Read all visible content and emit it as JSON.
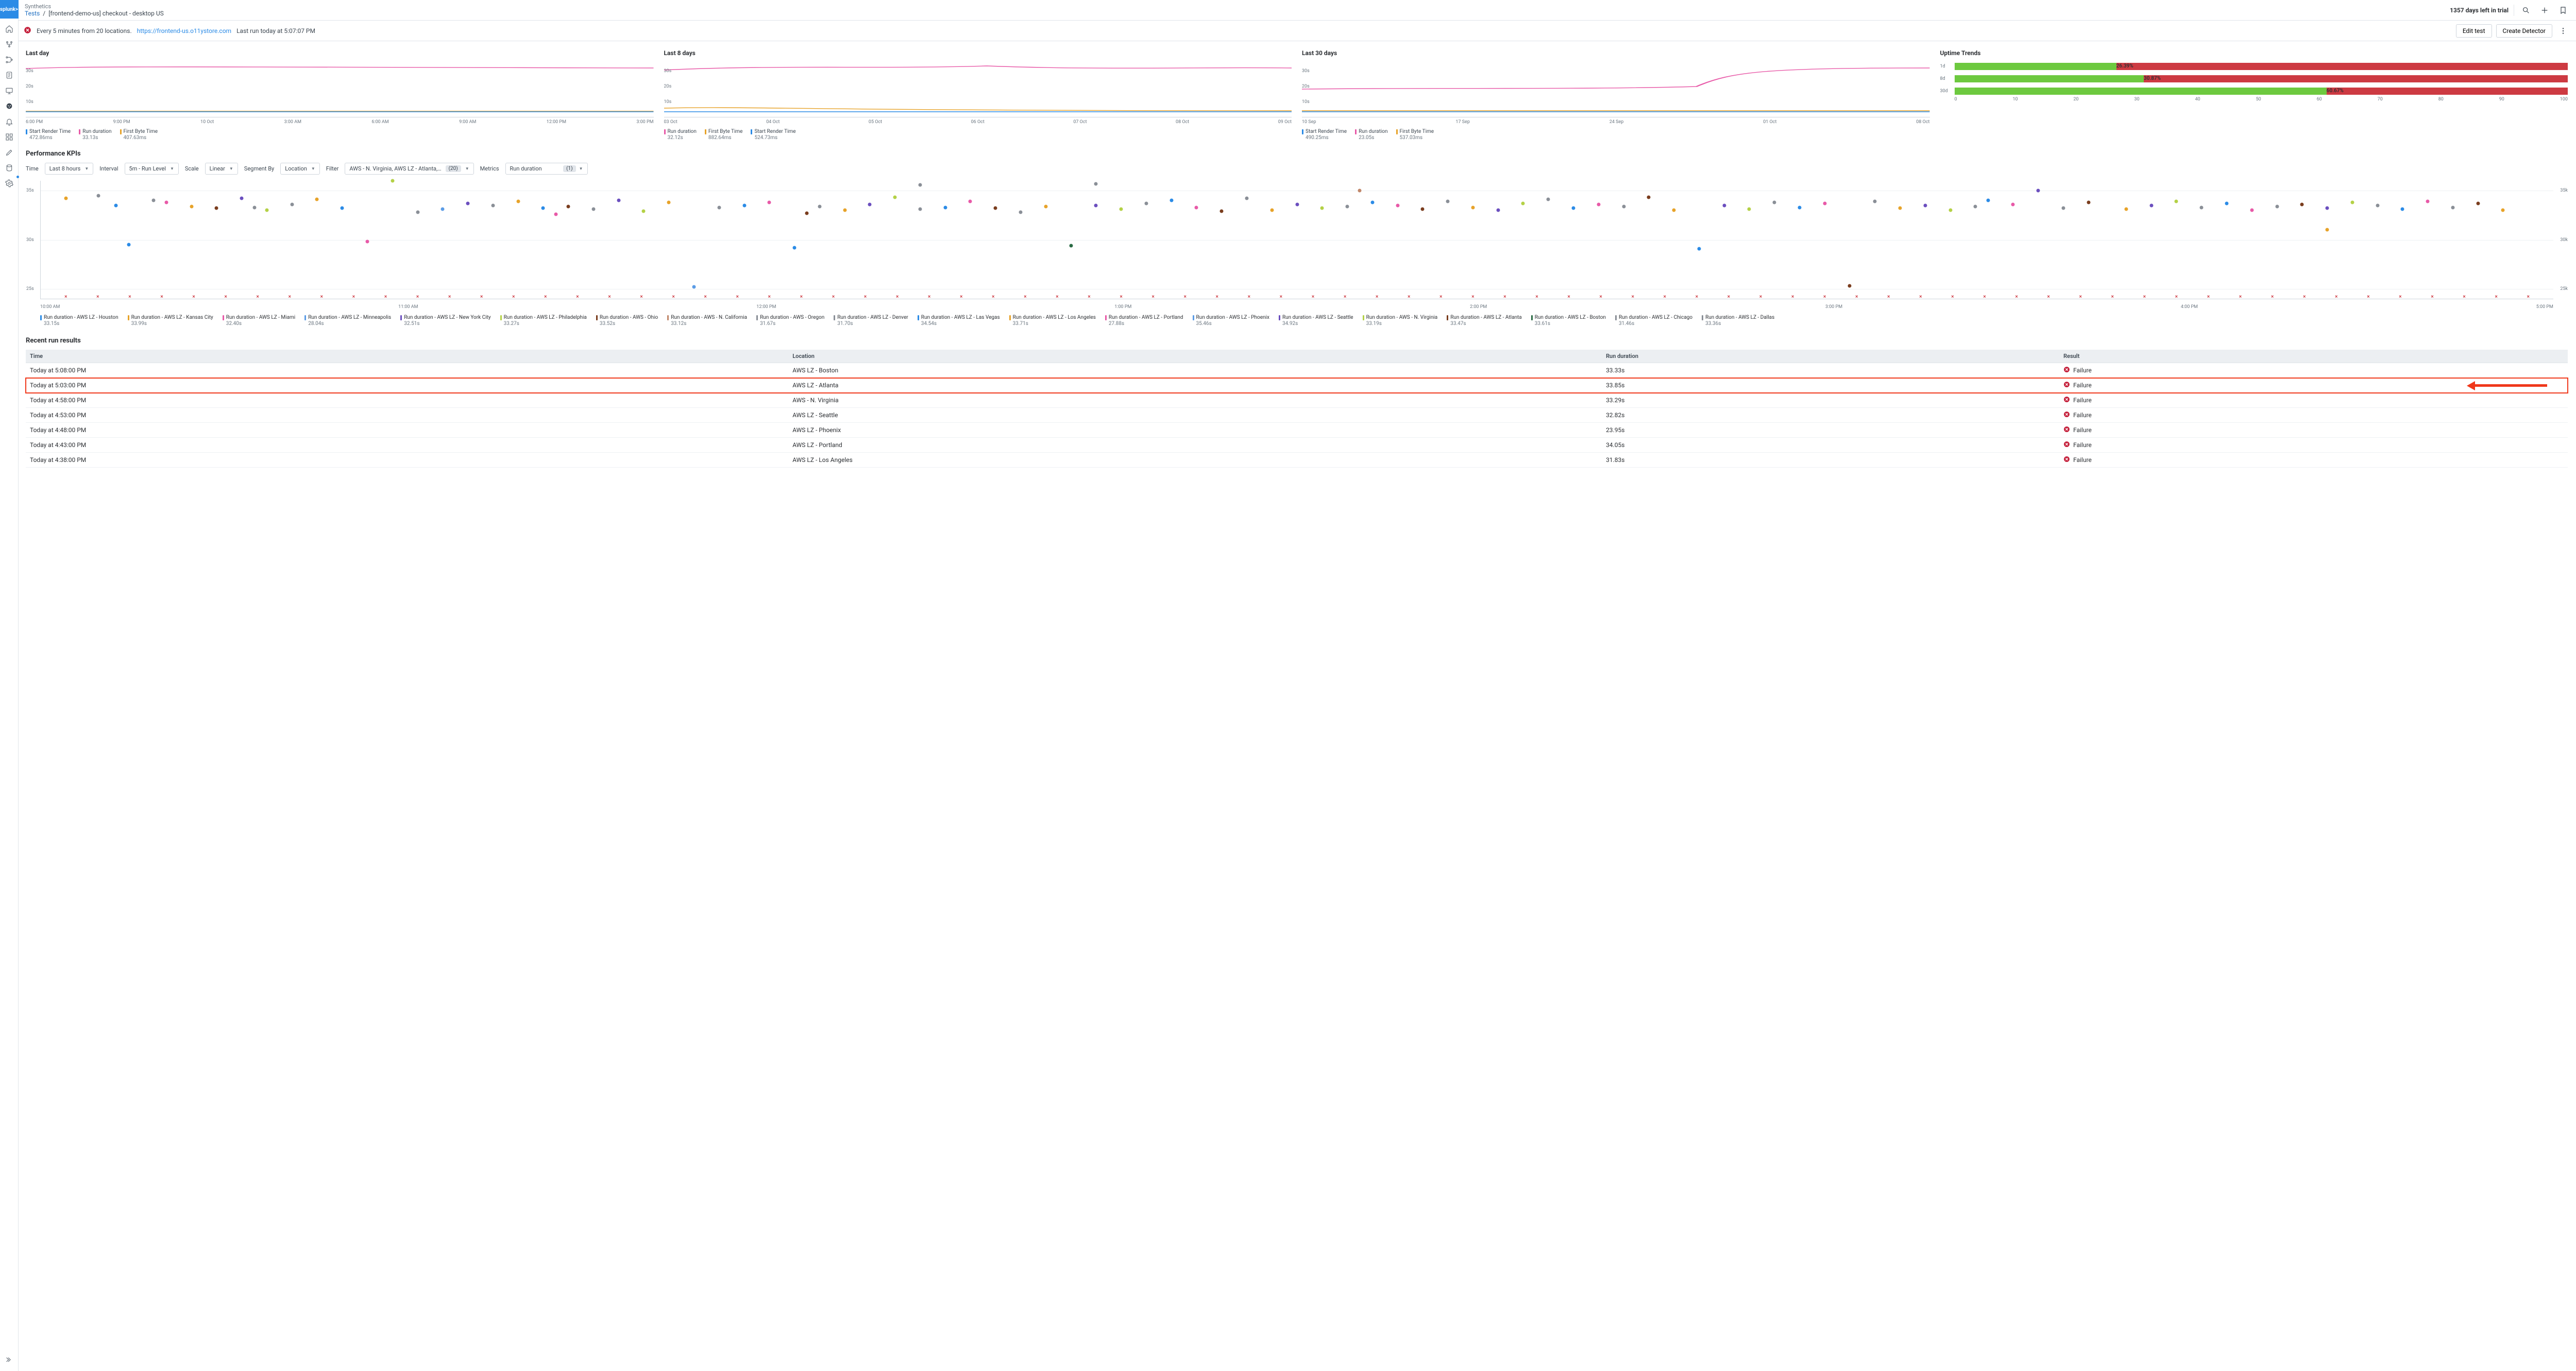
{
  "brand": "splunk>",
  "breadcrumb": {
    "root": "Synthetics",
    "tests": "Tests",
    "current": "[frontend-demo-us] checkout - desktop US"
  },
  "topbar": {
    "trial": "1357 days left in trial"
  },
  "actionbar": {
    "schedule": "Every 5 minutes from 20 locations.",
    "url": "https://frontend-us.o11ystore.com",
    "lastrun": "Last run today at 5:07:07 PM",
    "edit": "Edit test",
    "createDetector": "Create Detector"
  },
  "mini": [
    {
      "title": "Last day",
      "yt": [
        "30s",
        "20s",
        "10s"
      ],
      "xt": [
        "6:00 PM",
        "9:00 PM",
        "10 Oct",
        "3:00 AM",
        "6:00 AM",
        "9:00 AM",
        "12:00 PM",
        "3:00 PM"
      ],
      "legend": [
        {
          "label": "Start Render Time",
          "val": "472.86ms",
          "c": "#2b8be6"
        },
        {
          "label": "Run duration",
          "val": "33.13s",
          "c": "#e85aa8"
        },
        {
          "label": "First Byte Time",
          "val": "407.63ms",
          "c": "#e7a32a"
        }
      ]
    },
    {
      "title": "Last 8 days",
      "yt": [
        "30s",
        "20s",
        "10s"
      ],
      "xt": [
        "03 Oct",
        "04 Oct",
        "05 Oct",
        "06 Oct",
        "07 Oct",
        "08 Oct",
        "09 Oct"
      ],
      "legend": [
        {
          "label": "Run duration",
          "val": "32.12s",
          "c": "#e85aa8"
        },
        {
          "label": "First Byte Time",
          "val": "882.64ms",
          "c": "#e7a32a"
        },
        {
          "label": "Start Render Time",
          "val": "524.73ms",
          "c": "#2b8be6"
        }
      ]
    },
    {
      "title": "Last 30 days",
      "yt": [
        "30s",
        "20s",
        "10s"
      ],
      "xt": [
        "10 Sep",
        "17 Sep",
        "24 Sep",
        "01 Oct",
        "08 Oct"
      ],
      "legend": [
        {
          "label": "Start Render Time",
          "val": "490.25ms",
          "c": "#2b8be6"
        },
        {
          "label": "Run duration",
          "val": "23.05s",
          "c": "#e85aa8"
        },
        {
          "label": "First Byte Time",
          "val": "537.03ms",
          "c": "#e7a32a"
        }
      ]
    }
  ],
  "trends": {
    "title": "Uptime Trends",
    "rows": [
      {
        "lbl": "1d",
        "pct": "26.39%",
        "pctv": 26.39
      },
      {
        "lbl": "8d",
        "pct": "30.87%",
        "pctv": 30.87
      },
      {
        "lbl": "30d",
        "pct": "60.67%",
        "pctv": 60.67
      }
    ],
    "xt": [
      "0",
      "10",
      "20",
      "30",
      "40",
      "50",
      "60",
      "70",
      "80",
      "90",
      "100"
    ]
  },
  "kpi": {
    "title": "Performance KPIs",
    "labels": {
      "time": "Time",
      "interval": "Interval",
      "scale": "Scale",
      "segment": "Segment By",
      "filter": "Filter",
      "metrics": "Metrics"
    },
    "time": "Last 8 hours",
    "interval": "5m - Run Level",
    "scale": "Linear",
    "segment": "Location",
    "filterText": "AWS - N. Virginia, AWS LZ - Atlanta,…",
    "filterCount": "(20)",
    "metricsText": "Run duration",
    "metricsCount": "(1)"
  },
  "chart_data": {
    "type": "scatter",
    "ylabel": "Run duration",
    "ylim": [
      24,
      36
    ],
    "yticks": [
      "35s",
      "30s",
      "25s"
    ],
    "yticks_r": [
      "35k",
      "30k",
      "25k"
    ],
    "xticks": [
      "10:00 AM",
      "11:00 AM",
      "12:00 PM",
      "1:00 PM",
      "2:00 PM",
      "3:00 PM",
      "4:00 PM",
      "5:00 PM"
    ],
    "series": [
      {
        "name": "Run duration - AWS LZ - Houston",
        "val": "33.15s",
        "c": "#2b8be6"
      },
      {
        "name": "Run duration - AWS LZ - Kansas City",
        "val": "33.99s",
        "c": "#e7a32a"
      },
      {
        "name": "Run duration - AWS LZ - Miami",
        "val": "32.40s",
        "c": "#e85aa8"
      },
      {
        "name": "Run duration - AWS LZ - Minneapolis",
        "val": "28.04s",
        "c": "#5b9ce6"
      },
      {
        "name": "Run duration - AWS LZ - New York City",
        "val": "32.51s",
        "c": "#6b4fbf"
      },
      {
        "name": "Run duration - AWS LZ - Philadelphia",
        "val": "33.27s",
        "c": "#b4d146"
      },
      {
        "name": "Run duration - AWS - Ohio",
        "val": "33.52s",
        "c": "#7a3d1e"
      },
      {
        "name": "Run duration - AWS - N. California",
        "val": "33.12s",
        "c": "#c1876a"
      },
      {
        "name": "Run duration - AWS - Oregon",
        "val": "31.67s",
        "c": "#8a8f97"
      },
      {
        "name": "Run duration - AWS LZ - Denver",
        "val": "31.70s",
        "c": "#8a8f97"
      },
      {
        "name": "Run duration - AWS LZ - Las Vegas",
        "val": "34.54s",
        "c": "#2b8be6"
      },
      {
        "name": "Run duration - AWS LZ - Los Angeles",
        "val": "33.71s",
        "c": "#e7a32a"
      },
      {
        "name": "Run duration - AWS LZ - Portland",
        "val": "27.88s",
        "c": "#e85aa8"
      },
      {
        "name": "Run duration - AWS LZ - Phoenix",
        "val": "35.46s",
        "c": "#5b9ce6"
      },
      {
        "name": "Run duration - AWS LZ - Seattle",
        "val": "34.92s",
        "c": "#6b4fbf"
      },
      {
        "name": "Run duration - AWS - N. Virginia",
        "val": "33.19s",
        "c": "#b4d146"
      },
      {
        "name": "Run duration - AWS LZ - Atlanta",
        "val": "33.47s",
        "c": "#7a3d1e"
      },
      {
        "name": "Run duration - AWS LZ - Boston",
        "val": "33.61s",
        "c": "#2a6b44"
      },
      {
        "name": "Run duration - AWS LZ - Chicago",
        "val": "31.46s",
        "c": "#8a8f97"
      },
      {
        "name": "Run duration - AWS LZ - Dallas",
        "val": "33.36s",
        "c": "#8a8f97"
      }
    ],
    "points": [
      {
        "x": 1,
        "y": 34.2,
        "c": "#e7a32a"
      },
      {
        "x": 2.3,
        "y": 34.5,
        "c": "#8a8f97"
      },
      {
        "x": 3,
        "y": 33.5,
        "c": "#2b8be6"
      },
      {
        "x": 3.5,
        "y": 29.5,
        "c": "#2b8be6"
      },
      {
        "x": 4.5,
        "y": 34.0,
        "c": "#8a8f97"
      },
      {
        "x": 5,
        "y": 33.8,
        "c": "#e85aa8"
      },
      {
        "x": 6,
        "y": 33.4,
        "c": "#e7a32a"
      },
      {
        "x": 7,
        "y": 33.2,
        "c": "#7a3d1e"
      },
      {
        "x": 8,
        "y": 34.2,
        "c": "#6b4fbf"
      },
      {
        "x": 8.5,
        "y": 33.3,
        "c": "#8a8f97"
      },
      {
        "x": 9,
        "y": 33.0,
        "c": "#b4d146"
      },
      {
        "x": 10,
        "y": 33.6,
        "c": "#8a8f97"
      },
      {
        "x": 11,
        "y": 34.1,
        "c": "#e7a32a"
      },
      {
        "x": 12,
        "y": 33.2,
        "c": "#2b8be6"
      },
      {
        "x": 13,
        "y": 29.8,
        "c": "#e85aa8"
      },
      {
        "x": 14,
        "y": 36.0,
        "c": "#b4d146"
      },
      {
        "x": 15,
        "y": 32.8,
        "c": "#8a8f97"
      },
      {
        "x": 16,
        "y": 33.1,
        "c": "#5b9ce6"
      },
      {
        "x": 17,
        "y": 33.7,
        "c": "#6b4fbf"
      },
      {
        "x": 18,
        "y": 33.5,
        "c": "#8a8f97"
      },
      {
        "x": 19,
        "y": 33.9,
        "c": "#e7a32a"
      },
      {
        "x": 20,
        "y": 33.2,
        "c": "#2b8be6"
      },
      {
        "x": 20.5,
        "y": 32.6,
        "c": "#e85aa8"
      },
      {
        "x": 21,
        "y": 33.4,
        "c": "#7a3d1e"
      },
      {
        "x": 22,
        "y": 33.1,
        "c": "#8a8f97"
      },
      {
        "x": 23,
        "y": 34.0,
        "c": "#6b4fbf"
      },
      {
        "x": 24,
        "y": 32.9,
        "c": "#b4d146"
      },
      {
        "x": 25,
        "y": 33.8,
        "c": "#e7a32a"
      },
      {
        "x": 26,
        "y": 25.2,
        "c": "#5b9ce6"
      },
      {
        "x": 27,
        "y": 33.3,
        "c": "#8a8f97"
      },
      {
        "x": 28,
        "y": 33.5,
        "c": "#2b8be6"
      },
      {
        "x": 29,
        "y": 33.8,
        "c": "#e85aa8"
      },
      {
        "x": 30,
        "y": 29.2,
        "c": "#2b8be6"
      },
      {
        "x": 30.5,
        "y": 32.7,
        "c": "#7a3d1e"
      },
      {
        "x": 31,
        "y": 33.4,
        "c": "#8a8f97"
      },
      {
        "x": 32,
        "y": 33.0,
        "c": "#e7a32a"
      },
      {
        "x": 33,
        "y": 33.6,
        "c": "#6b4fbf"
      },
      {
        "x": 34,
        "y": 34.3,
        "c": "#b4d146"
      },
      {
        "x": 35,
        "y": 35.6,
        "c": "#8a8f97"
      },
      {
        "x": 35,
        "y": 33.1,
        "c": "#8a8f97"
      },
      {
        "x": 36,
        "y": 33.3,
        "c": "#2b8be6"
      },
      {
        "x": 37,
        "y": 33.9,
        "c": "#e85aa8"
      },
      {
        "x": 38,
        "y": 33.2,
        "c": "#7a3d1e"
      },
      {
        "x": 39,
        "y": 32.8,
        "c": "#8a8f97"
      },
      {
        "x": 40,
        "y": 33.4,
        "c": "#e7a32a"
      },
      {
        "x": 41,
        "y": 29.4,
        "c": "#2a6b44"
      },
      {
        "x": 42,
        "y": 35.7,
        "c": "#8a8f97"
      },
      {
        "x": 42,
        "y": 33.5,
        "c": "#6b4fbf"
      },
      {
        "x": 43,
        "y": 33.1,
        "c": "#b4d146"
      },
      {
        "x": 44,
        "y": 33.7,
        "c": "#8a8f97"
      },
      {
        "x": 45,
        "y": 34.0,
        "c": "#2b8be6"
      },
      {
        "x": 46,
        "y": 33.3,
        "c": "#e85aa8"
      },
      {
        "x": 47,
        "y": 32.9,
        "c": "#7a3d1e"
      },
      {
        "x": 48,
        "y": 34.2,
        "c": "#8a8f97"
      },
      {
        "x": 49,
        "y": 33.0,
        "c": "#e7a32a"
      },
      {
        "x": 50,
        "y": 33.6,
        "c": "#6b4fbf"
      },
      {
        "x": 51,
        "y": 33.2,
        "c": "#b4d146"
      },
      {
        "x": 52,
        "y": 33.4,
        "c": "#8a8f97"
      },
      {
        "x": 52.5,
        "y": 35.0,
        "c": "#c1876a"
      },
      {
        "x": 53,
        "y": 33.8,
        "c": "#2b8be6"
      },
      {
        "x": 54,
        "y": 33.5,
        "c": "#e85aa8"
      },
      {
        "x": 55,
        "y": 33.1,
        "c": "#7a3d1e"
      },
      {
        "x": 56,
        "y": 33.9,
        "c": "#8a8f97"
      },
      {
        "x": 57,
        "y": 33.3,
        "c": "#e7a32a"
      },
      {
        "x": 58,
        "y": 33.0,
        "c": "#6b4fbf"
      },
      {
        "x": 59,
        "y": 33.7,
        "c": "#b4d146"
      },
      {
        "x": 60,
        "y": 34.1,
        "c": "#8a8f97"
      },
      {
        "x": 61,
        "y": 33.2,
        "c": "#2b8be6"
      },
      {
        "x": 62,
        "y": 33.6,
        "c": "#e85aa8"
      },
      {
        "x": 63,
        "y": 33.4,
        "c": "#8a8f97"
      },
      {
        "x": 64,
        "y": 34.3,
        "c": "#7a3d1e"
      },
      {
        "x": 65,
        "y": 33.0,
        "c": "#e7a32a"
      },
      {
        "x": 66,
        "y": 29.1,
        "c": "#2b8be6"
      },
      {
        "x": 67,
        "y": 33.5,
        "c": "#6b4fbf"
      },
      {
        "x": 68,
        "y": 33.1,
        "c": "#b4d146"
      },
      {
        "x": 69,
        "y": 33.8,
        "c": "#8a8f97"
      },
      {
        "x": 70,
        "y": 33.3,
        "c": "#2b8be6"
      },
      {
        "x": 71,
        "y": 33.7,
        "c": "#e85aa8"
      },
      {
        "x": 72,
        "y": 25.3,
        "c": "#7a3d1e"
      },
      {
        "x": 73,
        "y": 33.9,
        "c": "#8a8f97"
      },
      {
        "x": 74,
        "y": 33.2,
        "c": "#e7a32a"
      },
      {
        "x": 75,
        "y": 33.5,
        "c": "#6b4fbf"
      },
      {
        "x": 76,
        "y": 33.0,
        "c": "#b4d146"
      },
      {
        "x": 77,
        "y": 33.4,
        "c": "#8a8f97"
      },
      {
        "x": 77.5,
        "y": 34.0,
        "c": "#2b8be6"
      },
      {
        "x": 78.5,
        "y": 33.6,
        "c": "#e85aa8"
      },
      {
        "x": 79.5,
        "y": 35.0,
        "c": "#6b4fbf"
      },
      {
        "x": 80.5,
        "y": 33.2,
        "c": "#8a8f97"
      },
      {
        "x": 81.5,
        "y": 33.8,
        "c": "#7a3d1e"
      },
      {
        "x": 83,
        "y": 33.1,
        "c": "#e7a32a"
      },
      {
        "x": 84,
        "y": 33.5,
        "c": "#6b4fbf"
      },
      {
        "x": 85,
        "y": 33.9,
        "c": "#b4d146"
      },
      {
        "x": 86,
        "y": 33.3,
        "c": "#8a8f97"
      },
      {
        "x": 87,
        "y": 33.7,
        "c": "#2b8be6"
      },
      {
        "x": 88,
        "y": 33.0,
        "c": "#e85aa8"
      },
      {
        "x": 89,
        "y": 33.4,
        "c": "#8a8f97"
      },
      {
        "x": 90,
        "y": 33.6,
        "c": "#7a3d1e"
      },
      {
        "x": 91,
        "y": 31.0,
        "c": "#e7a32a"
      },
      {
        "x": 91,
        "y": 33.2,
        "c": "#6b4fbf"
      },
      {
        "x": 92,
        "y": 33.8,
        "c": "#b4d146"
      },
      {
        "x": 93,
        "y": 33.5,
        "c": "#8a8f97"
      },
      {
        "x": 94,
        "y": 33.1,
        "c": "#2b8be6"
      },
      {
        "x": 95,
        "y": 33.9,
        "c": "#e85aa8"
      },
      {
        "x": 96,
        "y": 33.3,
        "c": "#8a8f97"
      },
      {
        "x": 97,
        "y": 33.7,
        "c": "#7a3d1e"
      },
      {
        "x": 98,
        "y": 33.0,
        "c": "#e7a32a"
      }
    ],
    "fail_marks": 78
  },
  "results": {
    "title": "Recent run results",
    "cols": [
      "Time",
      "Location",
      "Run duration",
      "Result"
    ],
    "rows": [
      {
        "time": "Today at 5:08:00 PM",
        "loc": "AWS LZ - Boston",
        "dur": "33.33s",
        "res": "Failure",
        "hl": false
      },
      {
        "time": "Today at 5:03:00 PM",
        "loc": "AWS LZ - Atlanta",
        "dur": "33.85s",
        "res": "Failure",
        "hl": true
      },
      {
        "time": "Today at 4:58:00 PM",
        "loc": "AWS - N. Virginia",
        "dur": "33.29s",
        "res": "Failure",
        "hl": false
      },
      {
        "time": "Today at 4:53:00 PM",
        "loc": "AWS LZ - Seattle",
        "dur": "32.82s",
        "res": "Failure",
        "hl": false
      },
      {
        "time": "Today at 4:48:00 PM",
        "loc": "AWS LZ - Phoenix",
        "dur": "23.95s",
        "res": "Failure",
        "hl": false
      },
      {
        "time": "Today at 4:43:00 PM",
        "loc": "AWS LZ - Portland",
        "dur": "34.05s",
        "res": "Failure",
        "hl": false
      },
      {
        "time": "Today at 4:38:00 PM",
        "loc": "AWS LZ - Los Angeles",
        "dur": "31.83s",
        "res": "Failure",
        "hl": false
      }
    ]
  }
}
